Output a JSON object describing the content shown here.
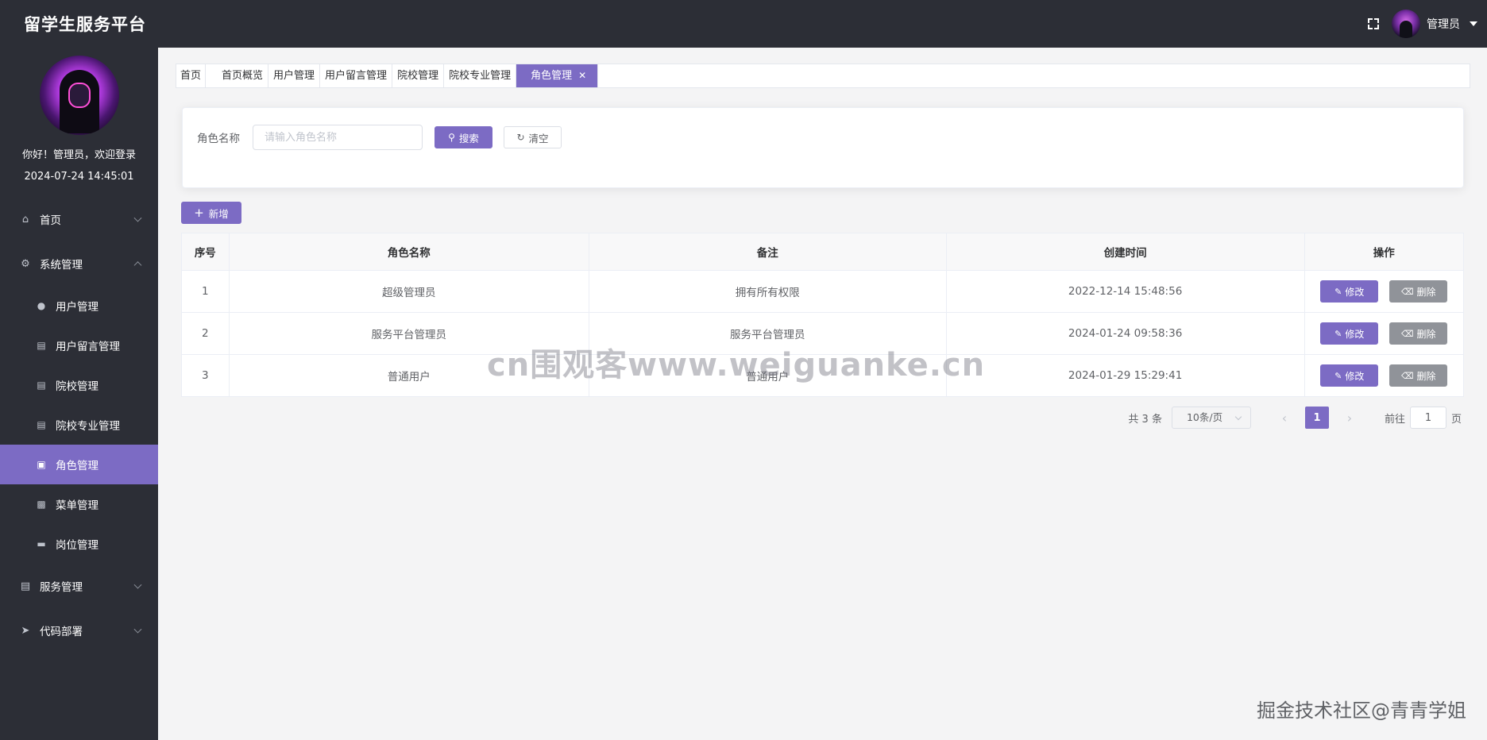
{
  "app": {
    "title": "留学生服务平台"
  },
  "header": {
    "admin_name": "管理员"
  },
  "sidebar": {
    "welcome": "你好！管理员，欢迎登录",
    "datetime": "2024-07-24 14:45:01",
    "items": [
      {
        "label": "首页",
        "icon": "home-icon"
      },
      {
        "label": "系统管理",
        "icon": "gear-icon"
      },
      {
        "label": "服务管理",
        "icon": "document-icon"
      },
      {
        "label": "代码部署",
        "icon": "paper-plane-icon"
      }
    ],
    "subitems": [
      {
        "label": "用户管理",
        "icon": "user-icon"
      },
      {
        "label": "用户留言管理",
        "icon": "document-icon"
      },
      {
        "label": "院校管理",
        "icon": "document-icon"
      },
      {
        "label": "院校专业管理",
        "icon": "document-icon"
      },
      {
        "label": "角色管理",
        "icon": "briefcase-icon",
        "active": true
      },
      {
        "label": "菜单管理",
        "icon": "clipboard-icon"
      },
      {
        "label": "岗位管理",
        "icon": "ticket-icon"
      }
    ]
  },
  "tabs": [
    "首页",
    "首页概览",
    "用户管理",
    "用户留言管理",
    "院校管理",
    "院校专业管理",
    "角色管理"
  ],
  "search": {
    "label": "角色名称",
    "placeholder": "请输入角色名称",
    "search_label": "搜索",
    "clear_label": "清空"
  },
  "toolbar": {
    "add_label": "新增"
  },
  "table": {
    "headers": [
      "序号",
      "角色名称",
      "备注",
      "创建时间",
      "操作"
    ],
    "rows": [
      {
        "index": "1",
        "name": "超级管理员",
        "remark": "拥有所有权限",
        "created": "2022-12-14 15:48:56"
      },
      {
        "index": "2",
        "name": "服务平台管理员",
        "remark": "服务平台管理员",
        "created": "2024-01-24 09:58:36"
      },
      {
        "index": "3",
        "name": "普通用户",
        "remark": "普通用户",
        "created": "2024-01-29 15:29:41"
      }
    ],
    "edit_label": "修改",
    "delete_label": "删除"
  },
  "pagination": {
    "total": "共 3 条",
    "page_size": "10条/页",
    "current_page": "1",
    "goto_label": "前往",
    "goto_value": "1",
    "page_unit": "页"
  },
  "overlay": {
    "watermark": "cn围观客www.weiguanke.cn",
    "credit": "掘金技术社区@青青学姐"
  },
  "colors": {
    "accent": "#7c6bc4",
    "sidebar_bg": "#2c2e36",
    "header_bg": "#2c2e36",
    "delete": "#909399"
  }
}
